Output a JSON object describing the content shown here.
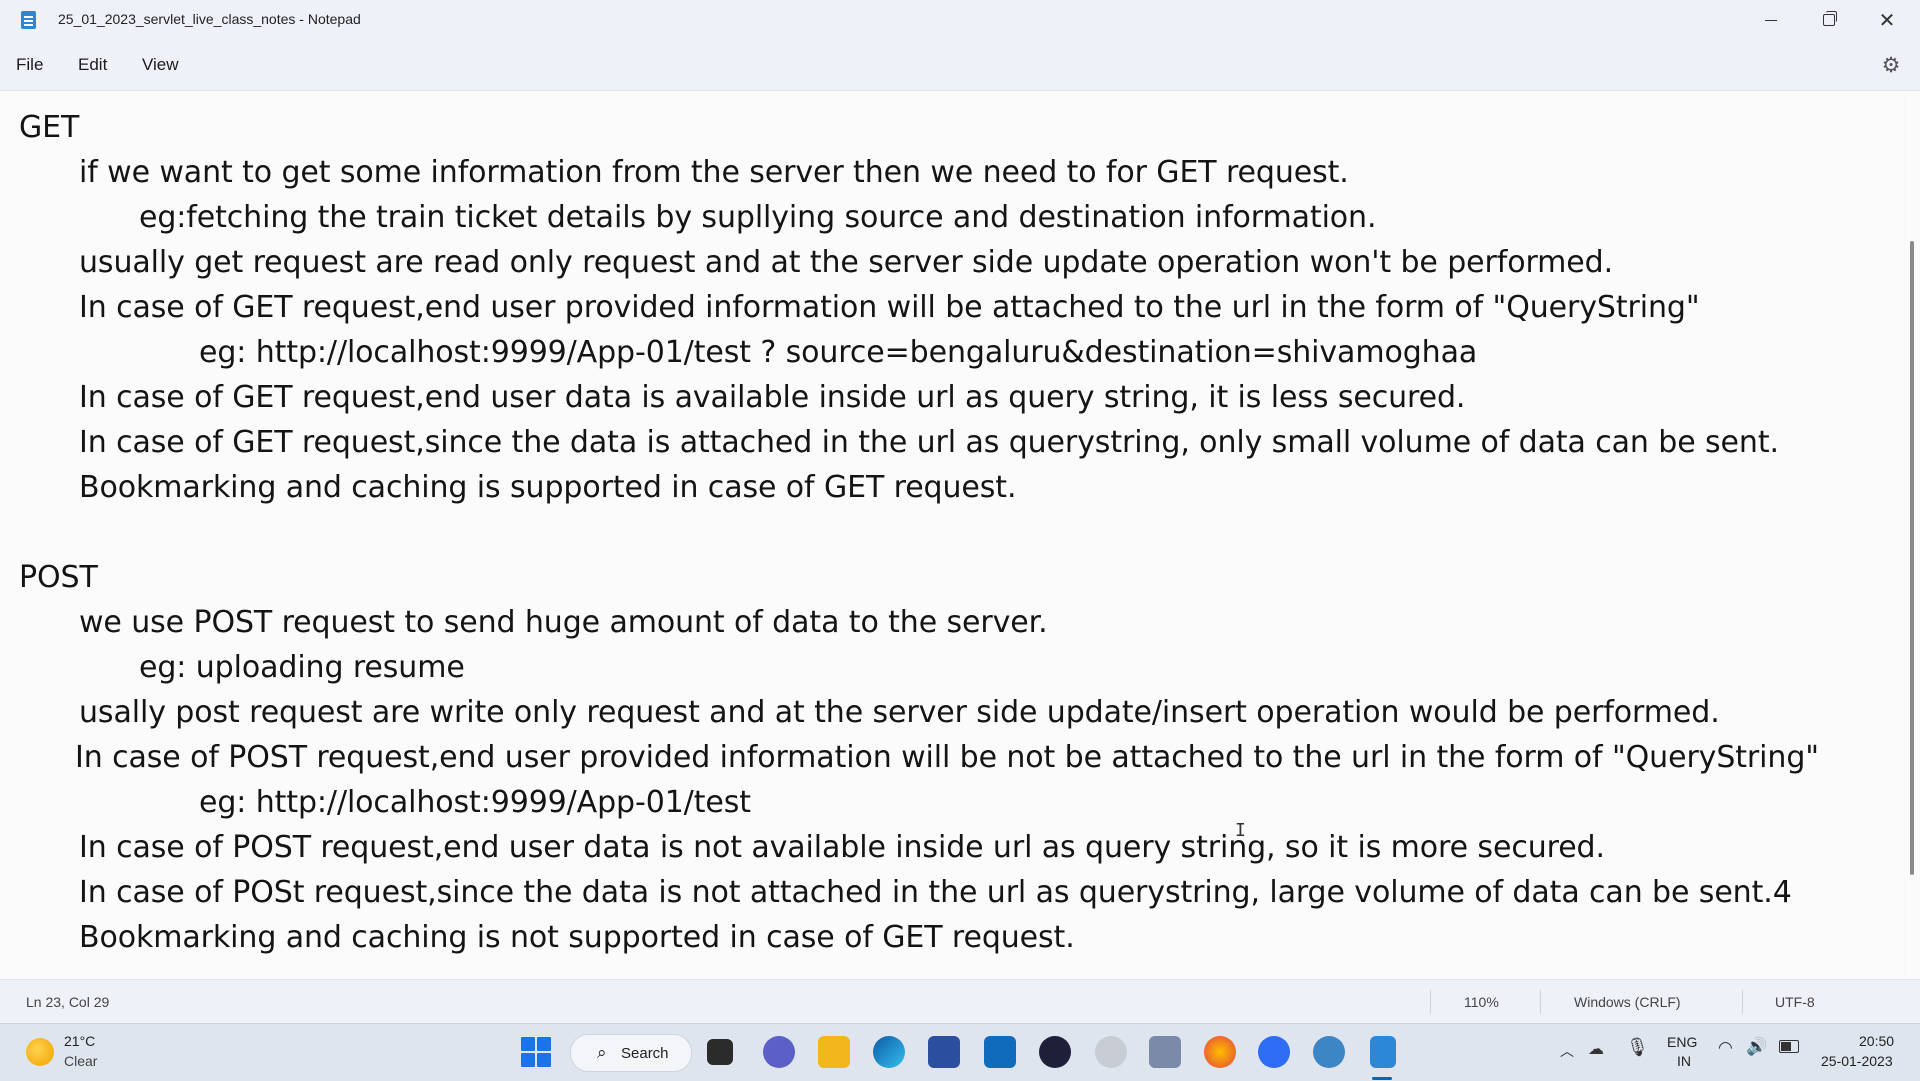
{
  "window": {
    "title": "25_01_2023_servlet_live_class_notes - Notepad",
    "minimize_glyph": "",
    "close_glyph": "✕"
  },
  "menu": {
    "file": "File",
    "edit": "Edit",
    "view": "View"
  },
  "editor": {
    "lines": [
      "GET",
      "if we want to get some information from the server then we need to for GET request.",
      "eg:fetching the train ticket details by supllying source and destination information.",
      "usually get request are read only request and at the server side update operation won't be performed.",
      "In case of GET request,end user provided information will be attached to the url in the form of \"QueryString\"",
      "eg: http://localhost:9999/App-01/test ? source=bengaluru&destination=shivamoghaa",
      "In case of GET request,end user data is available inside url as query string, it is less secured.",
      "In case of GET request,since the data is attached in the url as querystring, only small volume of data can be sent.",
      "Bookmarking and caching is supported in case of GET request.",
      "POST",
      "we use POST request to send huge amount of data to the server.",
      "eg: uploading resume",
      "usally post request are write only request and at the server side update/insert operation would be performed.",
      "In case of POST request,end user provided information will be not be attached to the url in the form of \"QueryString\"",
      "eg: http://localhost:9999/App-01/test",
      "In case of POST request,end user data is not available inside url as query string, so it is more secured.",
      "In case of POSt request,since the data is not attached in the url as querystring, large volume of data can be sent.4",
      "Bookmarking and caching is not supported in case of GET request."
    ]
  },
  "status": {
    "position": "Ln 23, Col 29",
    "zoom": "110%",
    "line_ending": "Windows (CRLF)",
    "encoding": "UTF-8"
  },
  "taskbar": {
    "weather_temp": "21°C",
    "weather_condition": "Clear",
    "search_label": "Search",
    "lang_line1": "ENG",
    "lang_line2": "IN",
    "time": "20:50",
    "date": "25-01-2023",
    "icons": [
      "windows-start-icon",
      "search-icon",
      "task-view-icon",
      "chat-icon",
      "file-explorer-icon",
      "edge-icon",
      "store-icon",
      "mail-icon",
      "media-icon",
      "app-icon",
      "snipping-icon",
      "firefox-icon",
      "zoom-icon",
      "network-app-icon",
      "notepad-icon"
    ]
  }
}
